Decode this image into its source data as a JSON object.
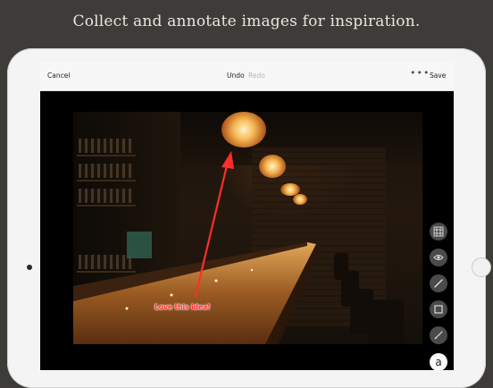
{
  "tagline": "Collect and annotate images for inspiration.",
  "toolbar": {
    "cancel": "Cancel",
    "undo": "Undo",
    "redo": "Redo",
    "more": "•••",
    "save": "Save"
  },
  "annotation": {
    "text": "Love this idea!",
    "color": "#ff2d2d"
  },
  "tools": [
    {
      "icon": "grid-icon"
    },
    {
      "icon": "eye-icon"
    },
    {
      "icon": "pen-icon"
    },
    {
      "icon": "rectangle-icon"
    },
    {
      "icon": "brush-icon"
    },
    {
      "icon": "text-icon",
      "label": "a"
    }
  ]
}
